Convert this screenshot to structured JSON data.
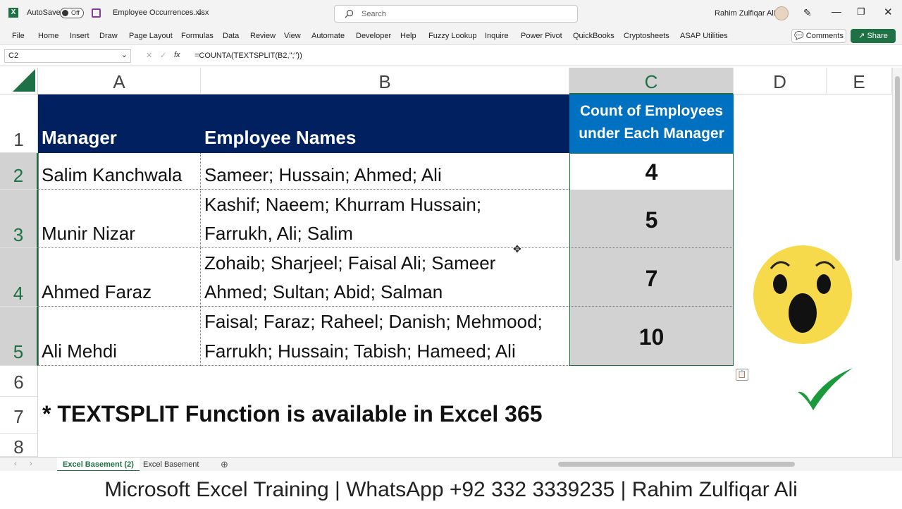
{
  "titlebar": {
    "autosave_label": "AutoSave",
    "autosave_state": "Off",
    "filename": "Employee Occurrences.xlsx",
    "search_placeholder": "Search",
    "user_name": "Rahim Zulfiqar Ali"
  },
  "ribbon": {
    "tabs": [
      "File",
      "Home",
      "Insert",
      "Draw",
      "Page Layout",
      "Formulas",
      "Data",
      "Review",
      "View",
      "Automate",
      "Developer",
      "Help",
      "Fuzzy Lookup",
      "Inquire",
      "Power Pivot",
      "QuickBooks",
      "Cryptosheets",
      "ASAP Utilities"
    ],
    "comments_label": "Comments",
    "share_label": "Share"
  },
  "formula_bar": {
    "name_box": "C2",
    "fx_label": "fx",
    "formula": "=COUNTA(TEXTSPLIT(B2,\";\"))"
  },
  "grid": {
    "columns": [
      "A",
      "B",
      "C",
      "D",
      "E"
    ],
    "rows": [
      "1",
      "2",
      "3",
      "4",
      "5",
      "6",
      "7",
      "8"
    ],
    "header": {
      "manager": "Manager",
      "employees": "Employee Names",
      "count_line1": "Count of Employees",
      "count_line2": "under Each Manager"
    },
    "data": [
      {
        "manager": "Salim Kanchwala",
        "names_line1": "Sameer; Hussain; Ahmed; Ali",
        "names_line2": "",
        "count": "4"
      },
      {
        "manager": "Munir Nizar",
        "names_line1": "Kashif; Naeem; Khurram Hussain;",
        "names_line2": "Farrukh, Ali; Salim",
        "count": "5"
      },
      {
        "manager": "Ahmed Faraz",
        "names_line1": "Zohaib; Sharjeel; Faisal Ali; Sameer",
        "names_line2": "Ahmed; Sultan; Abid; Salman",
        "count": "7"
      },
      {
        "manager": "Ali Mehdi",
        "names_line1": "Faisal; Faraz; Raheel; Danish; Mehmood;",
        "names_line2": "Farrukh; Hussain; Tabish; Hameed; Ali",
        "count": "10"
      }
    ],
    "note": "* TEXTSPLIT Function is available in Excel 365"
  },
  "sheets": {
    "tabs": [
      "Excel Basement (2)",
      "Excel Basement"
    ],
    "active": "Excel Basement (2)"
  },
  "banner": "Microsoft Excel Training | WhatsApp +92 332 3339235 | Rahim Zulfiqar Ali",
  "colors": {
    "excel_green": "#1e7145",
    "header_navy": "#002060",
    "header_blue": "#0070c0",
    "emoji_yellow": "#f7d94c",
    "check_green": "#1b9a3c"
  },
  "icons": [
    "excel-logo-icon",
    "save-icon",
    "search-icon",
    "pen-icon",
    "minimize-icon",
    "restore-icon",
    "close-icon",
    "add-sheet-icon",
    "shocked-emoji-icon",
    "checkmark-icon",
    "paste-options-icon"
  ]
}
